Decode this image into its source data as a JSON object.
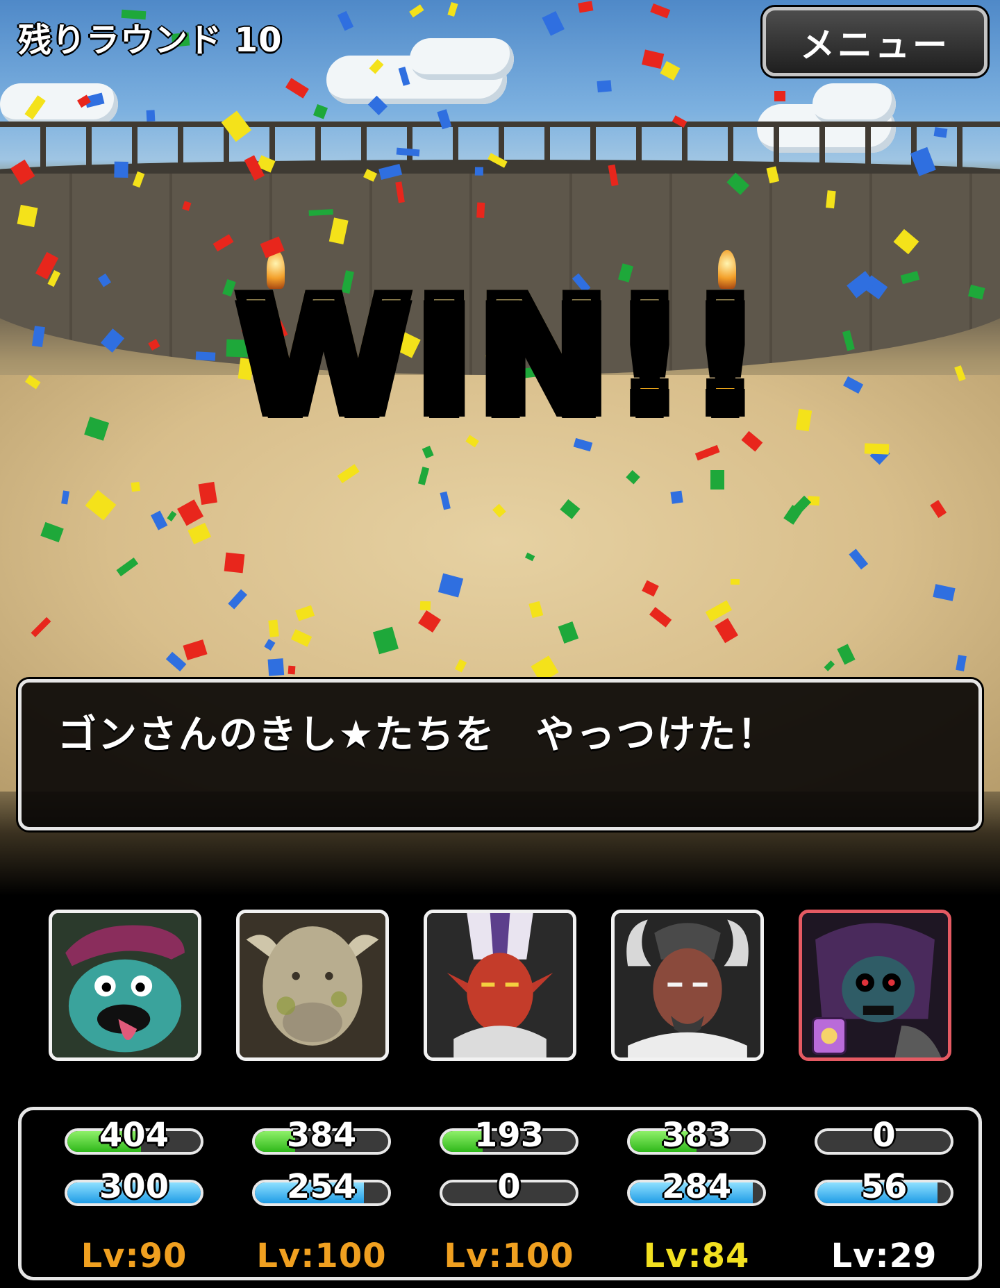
{
  "header": {
    "round_label": "残りラウンド 10",
    "menu_label": "メニュー"
  },
  "result": {
    "title": "WIN!!",
    "message": "ゴンさんのきし★たちを　やっつけた！"
  },
  "party": [
    {
      "portrait_icon": "teal-ghost-hat-monster-icon",
      "hp": "404",
      "hp_fraction": 0.55,
      "mp": "300",
      "mp_fraction": 1.0,
      "level": "Lv:90",
      "level_color": "#f0a020",
      "selected": false
    },
    {
      "portrait_icon": "stone-bull-monster-icon",
      "hp": "384",
      "hp_fraction": 0.3,
      "mp": "254",
      "mp_fraction": 0.82,
      "level": "Lv:100",
      "level_color": "#f0a020",
      "selected": false
    },
    {
      "portrait_icon": "red-demon-bishop-icon",
      "hp": "193",
      "hp_fraction": 0.3,
      "mp": "0",
      "mp_fraction": 0.0,
      "level": "Lv:100",
      "level_color": "#f0a020",
      "selected": false
    },
    {
      "portrait_icon": "horned-demon-lord-icon",
      "hp": "383",
      "hp_fraction": 0.5,
      "mp": "284",
      "mp_fraction": 0.92,
      "level": "Lv:84",
      "level_color": "#f2e020",
      "selected": false
    },
    {
      "portrait_icon": "purple-skull-knight-icon",
      "hp": "0",
      "hp_fraction": 0.0,
      "mp": "56",
      "mp_fraction": 0.9,
      "level": "Lv:29",
      "level_color": "#ffffff",
      "selected": true,
      "badge_icon": "role-badge-icon"
    }
  ]
}
